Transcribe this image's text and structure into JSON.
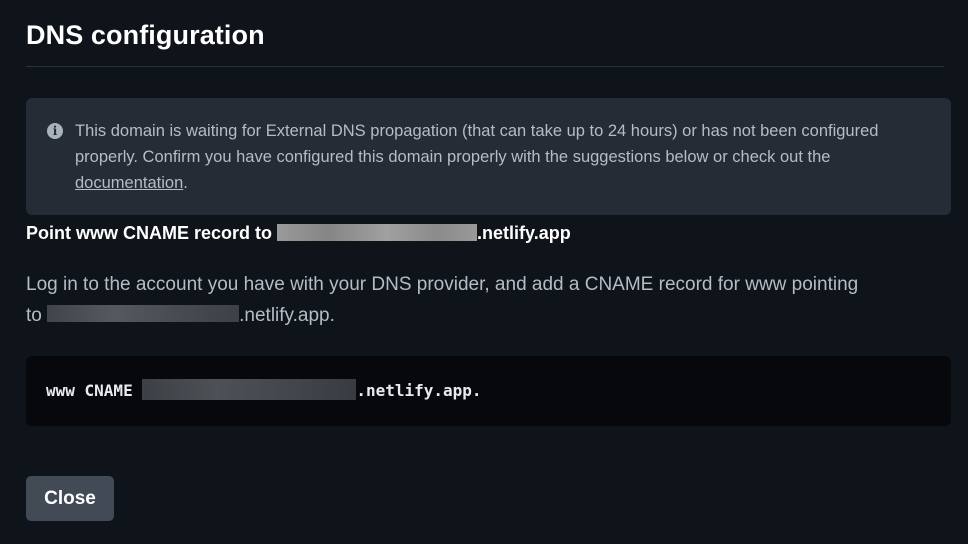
{
  "dialog": {
    "title": "DNS configuration"
  },
  "notice": {
    "icon": "info-icon",
    "text": "This domain is waiting for External DNS propagation (that can take up to 24 hours) or has not been configured properly. Confirm you have configured this domain properly with the suggestions below or check out the ",
    "link_label": "documentation",
    "suffix": "."
  },
  "record": {
    "heading_prefix": "Point www CNAME record to ",
    "heading_suffix": ".netlify.app",
    "instructions_prefix": "Log in to the account you have with your DNS provider, and add a CNAME record for www pointing to ",
    "instructions_suffix": ".netlify.app.",
    "code_prefix": "www CNAME ",
    "code_suffix": ".netlify.app."
  },
  "actions": {
    "close_label": "Close"
  },
  "colors": {
    "background": "#0f141a",
    "notice_background": "#262c35",
    "code_background": "#06080b",
    "button_background": "#414a55",
    "muted_text": "#b4bcc5"
  }
}
